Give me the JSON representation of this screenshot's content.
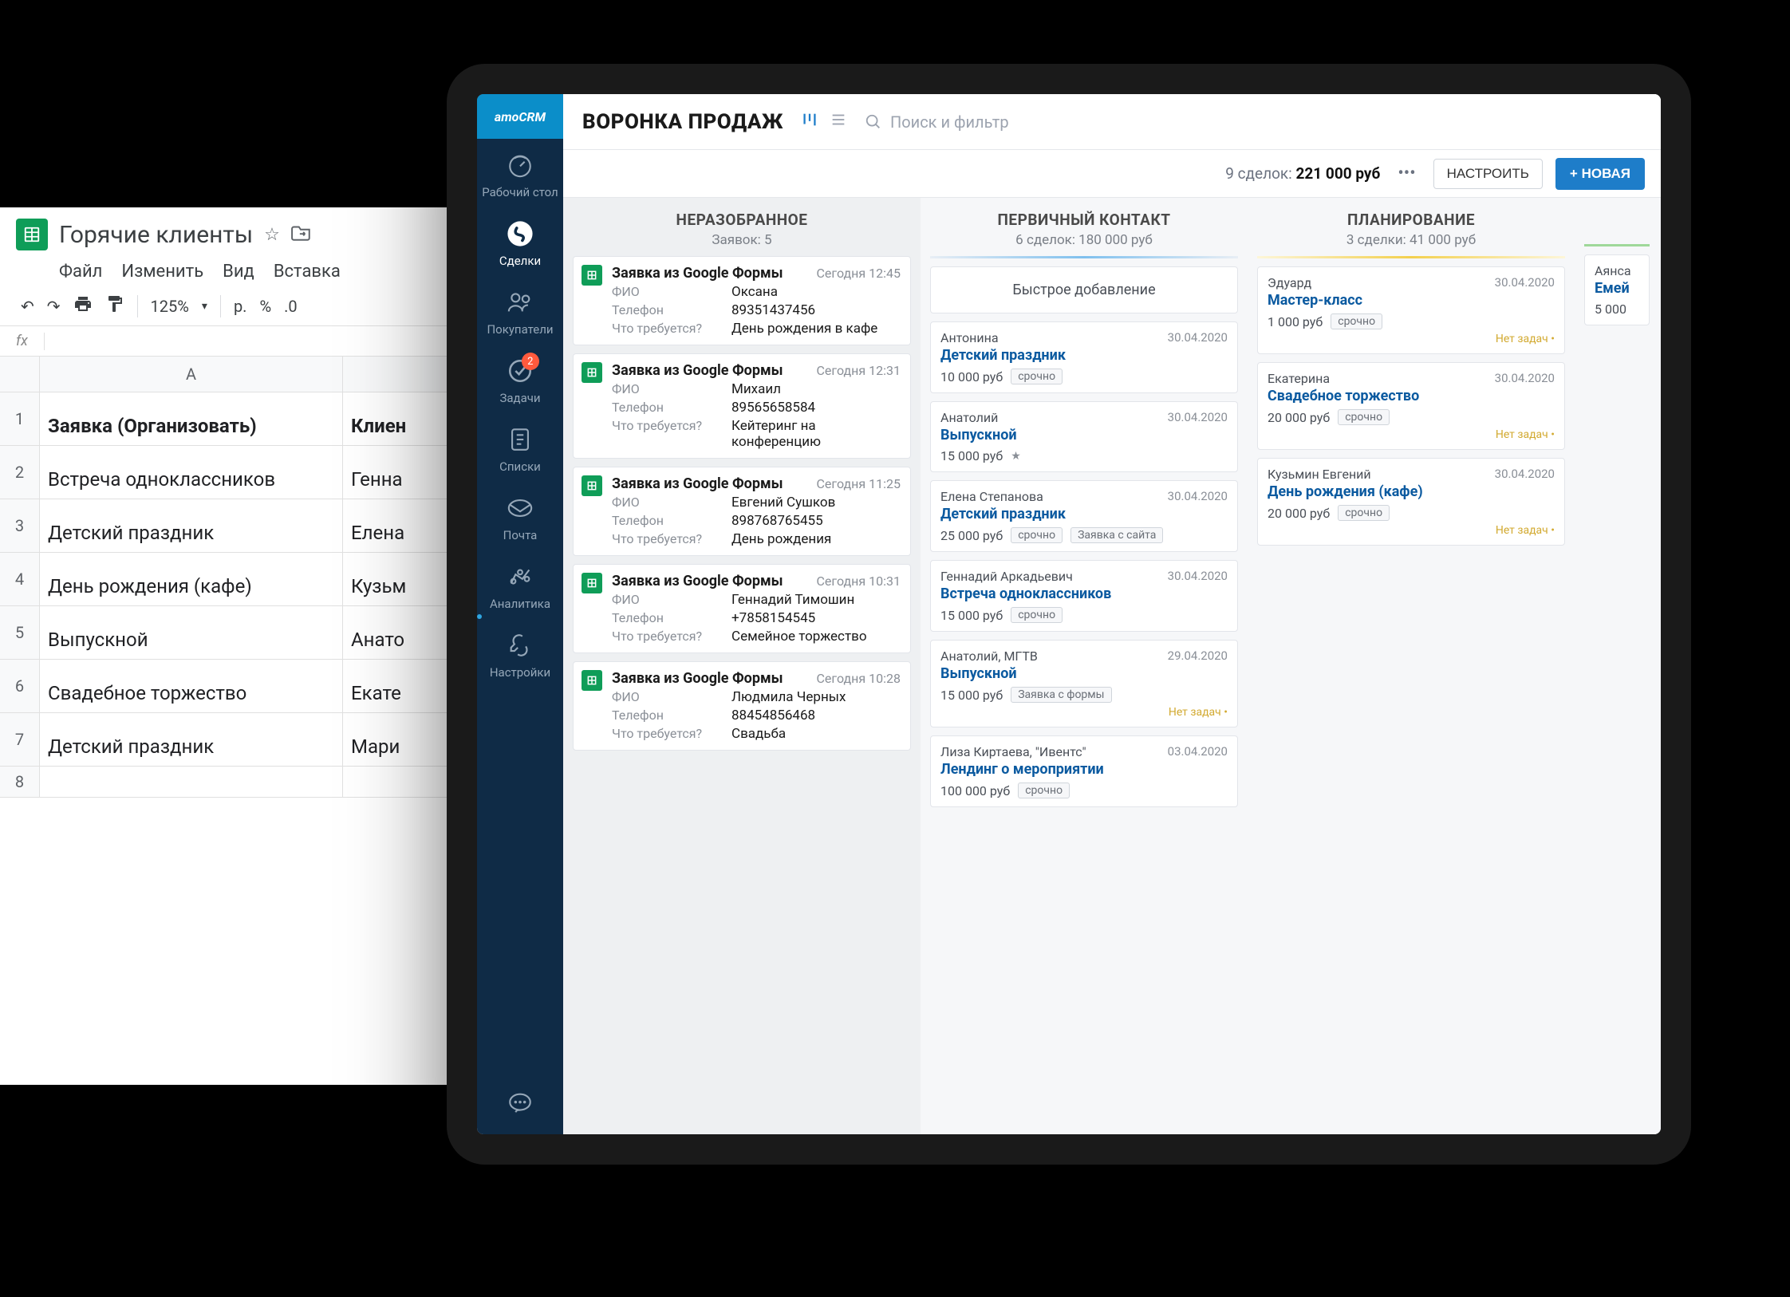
{
  "sheets": {
    "title": "Горячие клиенты",
    "menu": [
      "Файл",
      "Изменить",
      "Вид",
      "Вставка"
    ],
    "zoom": "125%",
    "currency": "р.",
    "percent": "%",
    "decimal": ".0",
    "fx_label": "fx",
    "col_a_label": "A",
    "header_a": "Заявка (Организовать)",
    "header_b": "Клиен",
    "rows": [
      {
        "num": "1",
        "a": "Заявка (Организовать)",
        "b": "Клиен",
        "bold": true
      },
      {
        "num": "2",
        "a": "Встреча одноклассников",
        "b": "Генна"
      },
      {
        "num": "3",
        "a": "Детский праздник",
        "b": "Елена"
      },
      {
        "num": "4",
        "a": "День рождения (кафе)",
        "b": "Кузьм"
      },
      {
        "num": "5",
        "a": "Выпускной",
        "b": "Анато"
      },
      {
        "num": "6",
        "a": "Свадебное торжество",
        "b": "Екате"
      },
      {
        "num": "7",
        "a": "Детский праздник",
        "b": "Мари"
      },
      {
        "num": "8",
        "a": "",
        "b": ""
      }
    ]
  },
  "crm": {
    "logo": "amoCRM",
    "sidebar": [
      {
        "label": "Рабочий стол"
      },
      {
        "label": "Сделки",
        "active": true
      },
      {
        "label": "Покупатели"
      },
      {
        "label": "Задачи",
        "badge": "2"
      },
      {
        "label": "Списки"
      },
      {
        "label": "Почта"
      },
      {
        "label": "Аналитика"
      },
      {
        "label": "Настройки"
      }
    ],
    "topbar": {
      "title": "ВОРОНКА ПРОДАЖ",
      "search_placeholder": "Поиск и фильтр"
    },
    "subbar": {
      "deals_text": "9 сделок:",
      "deals_sum": "221 000 руб",
      "configure": "НАСТРОИТЬ",
      "new": "+ НОВАЯ"
    },
    "columns": {
      "unsorted": {
        "title": "НЕРАЗОБРАННОЕ",
        "sub": "Заявок: 5",
        "field_labels": {
          "fio": "ФИО",
          "phone": "Телефон",
          "need": "Что требуется?"
        },
        "cards": [
          {
            "title": "Заявка из Google Формы",
            "time": "Сегодня 12:45",
            "fio": "Оксана",
            "phone": "89351437456",
            "need": "День рождения в кафе"
          },
          {
            "title": "Заявка из Google Формы",
            "time": "Сегодня 12:31",
            "fio": "Михаил",
            "phone": "89565658584",
            "need": "Кейтеринг на конференцию"
          },
          {
            "title": "Заявка из Google Формы",
            "time": "Сегодня 11:25",
            "fio": "Евгений Сушков",
            "phone": "898768765455",
            "need": "День рождения"
          },
          {
            "title": "Заявка из Google Формы",
            "time": "Сегодня 10:31",
            "fio": "Геннадий Тимошин",
            "phone": "+7858154545",
            "need": "Семейное торжество"
          },
          {
            "title": "Заявка из Google Формы",
            "time": "Сегодня 10:28",
            "fio": "Людмила Черных",
            "phone": "88454856468",
            "need": "Свадьба"
          }
        ]
      },
      "primary": {
        "title": "ПЕРВИЧНЫЙ КОНТАКТ",
        "sub": "6 сделок: 180 000 руб",
        "quick_add": "Быстрое добавление",
        "cards": [
          {
            "person": "Антонина",
            "date": "30.04.2020",
            "title": "Детский праздник",
            "price": "10 000 руб",
            "tags": [
              "срочно"
            ]
          },
          {
            "person": "Анатолий",
            "date": "30.04.2020",
            "title": "Выпускной",
            "price": "15 000 руб",
            "star": true
          },
          {
            "person": "Елена Степанова",
            "date": "30.04.2020",
            "title": "Детский праздник",
            "price": "25 000 руб",
            "tags": [
              "срочно",
              "Заявка с сайта"
            ]
          },
          {
            "person": "Геннадий Аркадьевич",
            "date": "30.04.2020",
            "title": "Встреча одноклассников",
            "price": "15 000 руб",
            "tags": [
              "срочно"
            ]
          },
          {
            "person": "Анатолий, МГТВ",
            "date": "29.04.2020",
            "title": "Выпускной",
            "price": "15 000 руб",
            "tags": [
              "Заявка с формы"
            ],
            "foot": "Нет задач"
          },
          {
            "person": "Лиза Киртаева, \"Ивентс\"",
            "date": "03.04.2020",
            "title": "Лендинг о мероприятии",
            "price": "100 000 руб",
            "tags": [
              "срочно"
            ]
          }
        ]
      },
      "planning": {
        "title": "ПЛАНИРОВАНИЕ",
        "sub": "3 сделки: 41 000 руб",
        "cards": [
          {
            "person": "Эдуард",
            "date": "30.04.2020",
            "title": "Мастер-класс",
            "price": "1 000 руб",
            "tags": [
              "срочно"
            ],
            "foot": "Нет задач"
          },
          {
            "person": "Екатерина",
            "date": "30.04.2020",
            "title": "Свадебное торжество",
            "price": "20 000 руб",
            "tags": [
              "срочно"
            ],
            "foot": "Нет задач"
          },
          {
            "person": "Кузьмин Евгений",
            "date": "30.04.2020",
            "title": "День рождения (кафе)",
            "price": "20 000 руб",
            "tags": [
              "срочно"
            ],
            "foot": "Нет задач"
          }
        ]
      },
      "extra": {
        "cards": [
          {
            "person": "Аянса",
            "title": "Емей",
            "price": "5 000"
          }
        ]
      }
    }
  }
}
